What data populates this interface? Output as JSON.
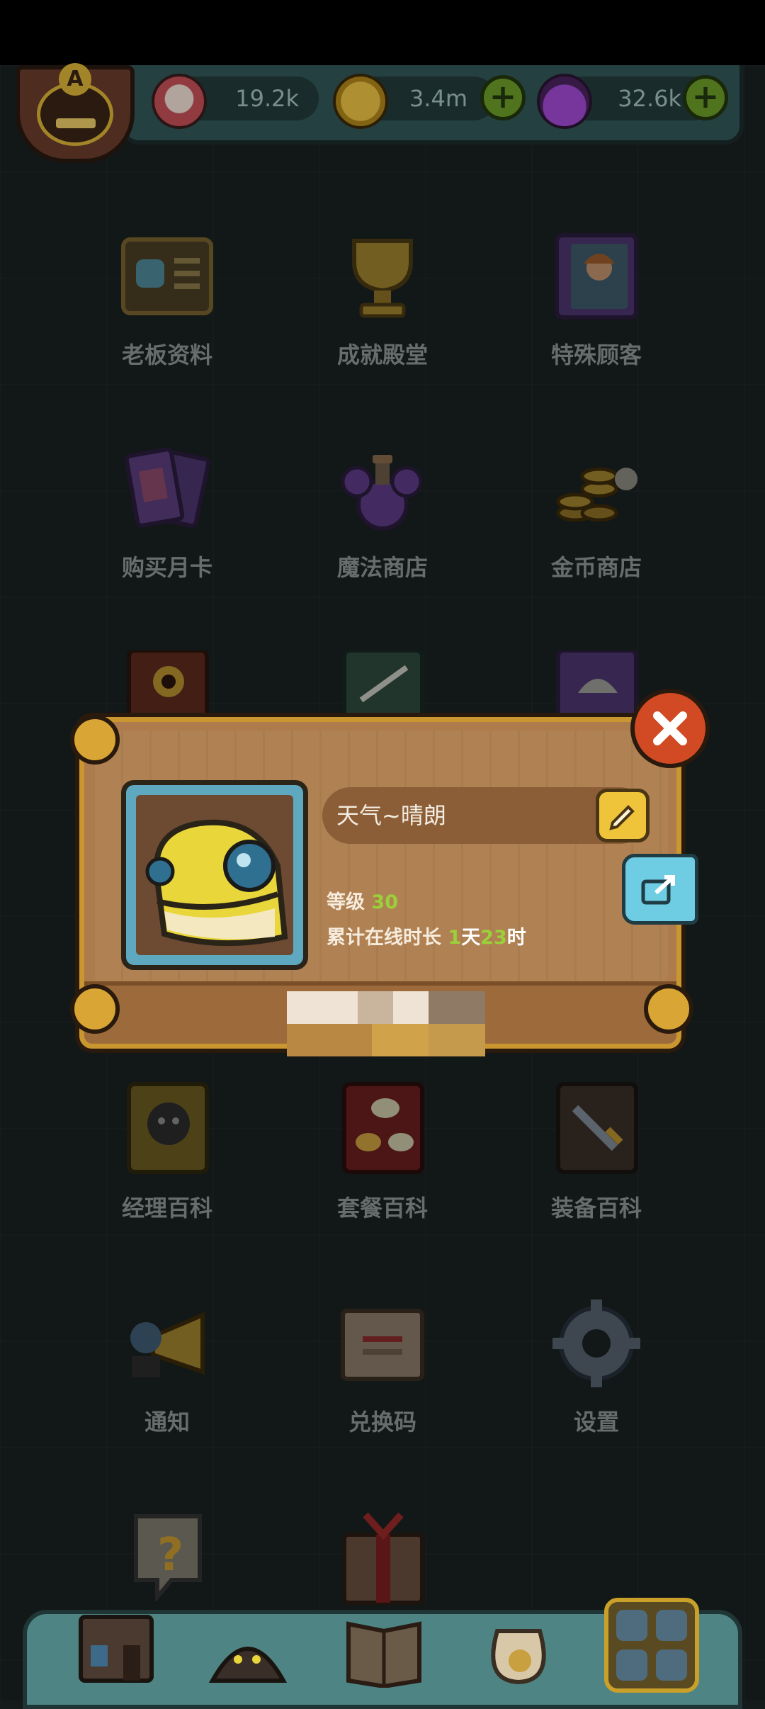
{
  "resources": [
    {
      "name": "eye",
      "value": "19.2k",
      "icon": "eyeball-icon"
    },
    {
      "name": "coin",
      "value": "3.4m",
      "icon": "gold-coin-icon"
    },
    {
      "name": "potion",
      "value": "32.6k",
      "icon": "potion-flask-icon"
    }
  ],
  "badge": {
    "letter": "A"
  },
  "menu": [
    {
      "label": "老板资料",
      "icon": "boss-profile-icon"
    },
    {
      "label": "成就殿堂",
      "icon": "trophy-icon"
    },
    {
      "label": "特殊顾客",
      "icon": "special-customer-icon"
    },
    {
      "label": "购买月卡",
      "icon": "monthly-card-icon"
    },
    {
      "label": "魔法商店",
      "icon": "magic-potion-shop-icon"
    },
    {
      "label": "金币商店",
      "icon": "gold-coin-shop-icon"
    },
    {
      "label": "经理百科",
      "icon": "manager-book-icon"
    },
    {
      "label": "套餐百科",
      "icon": "meal-book-icon"
    },
    {
      "label": "装备百科",
      "icon": "equipment-book-icon"
    },
    {
      "label": "通知",
      "icon": "megaphone-icon"
    },
    {
      "label": "兑换码",
      "icon": "redeem-scroll-icon"
    },
    {
      "label": "设置",
      "icon": "gear-icon"
    }
  ],
  "popup": {
    "name": "天气~晴朗",
    "level_label": "等级",
    "level_value": "30",
    "online_label": "累计在线时长",
    "online_days": "1",
    "online_days_unit": "天",
    "online_hours": "23",
    "online_hours_unit": "时"
  },
  "bottom_nav": [
    "shop-building-icon",
    "monster-nest-icon",
    "recipe-book-icon",
    "money-bag-icon",
    "grid-menu-icon"
  ],
  "colors": {
    "accent_green": "#9ad13a",
    "close_red": "#d24a24",
    "gold": "#f0c43a",
    "panel": "#b08152"
  }
}
